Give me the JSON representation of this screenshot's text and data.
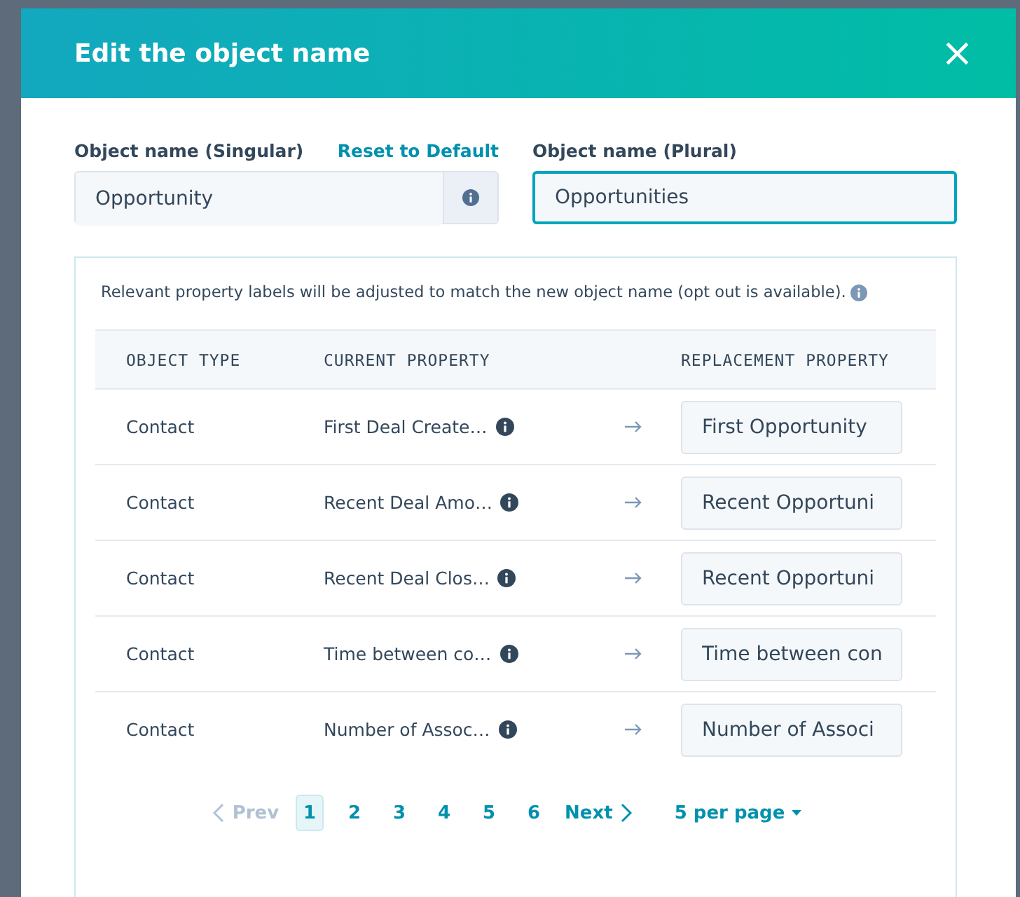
{
  "dialog": {
    "title": "Edit the object name",
    "close": "×"
  },
  "singular": {
    "label": "Object name (Singular)",
    "reset": "Reset to Default",
    "value": "Opportunity"
  },
  "plural": {
    "label": "Object name (Plural)",
    "value": "Opportunities",
    "focused": true
  },
  "notice": "Relevant property labels will be adjusted to match the new object name (opt out is available).",
  "table": {
    "columns": [
      "OBJECT TYPE",
      "CURRENT PROPERTY",
      "REPLACEMENT PROPERTY"
    ],
    "rows": [
      {
        "object_type": "Contact",
        "current": "First Deal Create…",
        "replacement": "First Opportunity"
      },
      {
        "object_type": "Contact",
        "current": "Recent Deal Amo…",
        "replacement": "Recent Opportuni"
      },
      {
        "object_type": "Contact",
        "current": "Recent Deal Clos…",
        "replacement": "Recent Opportuni"
      },
      {
        "object_type": "Contact",
        "current": "Time between co…",
        "replacement": "Time between con"
      },
      {
        "object_type": "Contact",
        "current": "Number of Assoc…",
        "replacement": "Number of Associ"
      }
    ]
  },
  "pagination": {
    "prev": {
      "label": "Prev",
      "disabled": true
    },
    "pages": [
      {
        "label": "1",
        "selected": true
      },
      {
        "label": "2",
        "selected": false
      },
      {
        "label": "3",
        "selected": false
      },
      {
        "label": "4",
        "selected": false
      },
      {
        "label": "5",
        "selected": false
      },
      {
        "label": "6",
        "selected": false
      }
    ],
    "next": {
      "label": "Next",
      "disabled": false
    },
    "per_page": "5 per page"
  }
}
